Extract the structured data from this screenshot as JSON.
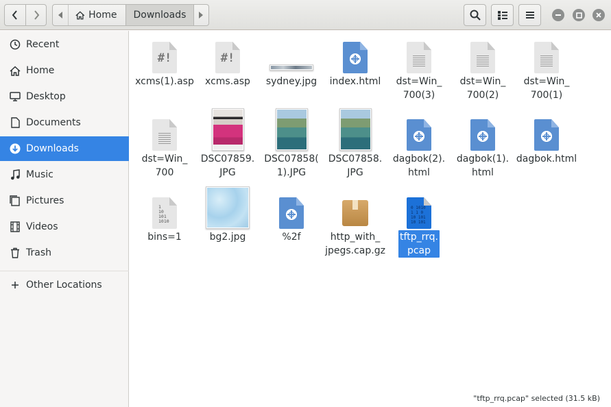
{
  "window": {
    "title": "Downloads"
  },
  "pathbar": {
    "home": "Home",
    "current": "Downloads"
  },
  "sidebar": {
    "items": [
      {
        "label": "Recent",
        "icon": "clock-icon"
      },
      {
        "label": "Home",
        "icon": "home-icon"
      },
      {
        "label": "Desktop",
        "icon": "desktop-icon"
      },
      {
        "label": "Documents",
        "icon": "document-icon"
      },
      {
        "label": "Downloads",
        "icon": "download-icon",
        "selected": true
      },
      {
        "label": "Music",
        "icon": "music-icon"
      },
      {
        "label": "Pictures",
        "icon": "pictures-icon"
      },
      {
        "label": "Videos",
        "icon": "video-icon"
      },
      {
        "label": "Trash",
        "icon": "trash-icon"
      }
    ],
    "other_locations": "Other Locations"
  },
  "files": [
    {
      "name": "xcms(1).asp",
      "type": "script"
    },
    {
      "name": "xcms.asp",
      "type": "script"
    },
    {
      "name": "sydney.jpg",
      "type": "image-strip"
    },
    {
      "name": "index.html",
      "type": "html"
    },
    {
      "name": "dst=Win_\n700(3)",
      "type": "text"
    },
    {
      "name": "dst=Win_\n700(2)",
      "type": "text"
    },
    {
      "name": "dst=Win_\n700(1)",
      "type": "text"
    },
    {
      "name": "dst=Win_\n700",
      "type": "text"
    },
    {
      "name": "DSC07859.\nJPG",
      "type": "photo-pink"
    },
    {
      "name": "DSC07858(\n1).JPG",
      "type": "photo-beach"
    },
    {
      "name": "DSC07858.\nJPG",
      "type": "photo-beach"
    },
    {
      "name": "dagbok(2).\nhtml",
      "type": "html"
    },
    {
      "name": "dagbok(1).\nhtml",
      "type": "html"
    },
    {
      "name": "dagbok.html",
      "type": "html"
    },
    {
      "name": "bins=1",
      "type": "binary"
    },
    {
      "name": "bg2.jpg",
      "type": "photo-sky"
    },
    {
      "name": "%2f",
      "type": "html"
    },
    {
      "name": "http_with_\njpegs.cap.gz",
      "type": "archive"
    },
    {
      "name": "tftp_rrq.\npcap",
      "type": "pcap",
      "selected": true
    }
  ],
  "script_mark": "#!",
  "binary_mark": "1\n10\n101\n1010",
  "pcap_mark": "0 1010\n1 1 0\n10 101\n10 101",
  "status": "\"tftp_rrq.pcap\" selected  (31.5 kB)",
  "colors": {
    "accent": "#3584e4",
    "html_doc": "#5a8fd1",
    "pcap": "#1c71d8"
  }
}
